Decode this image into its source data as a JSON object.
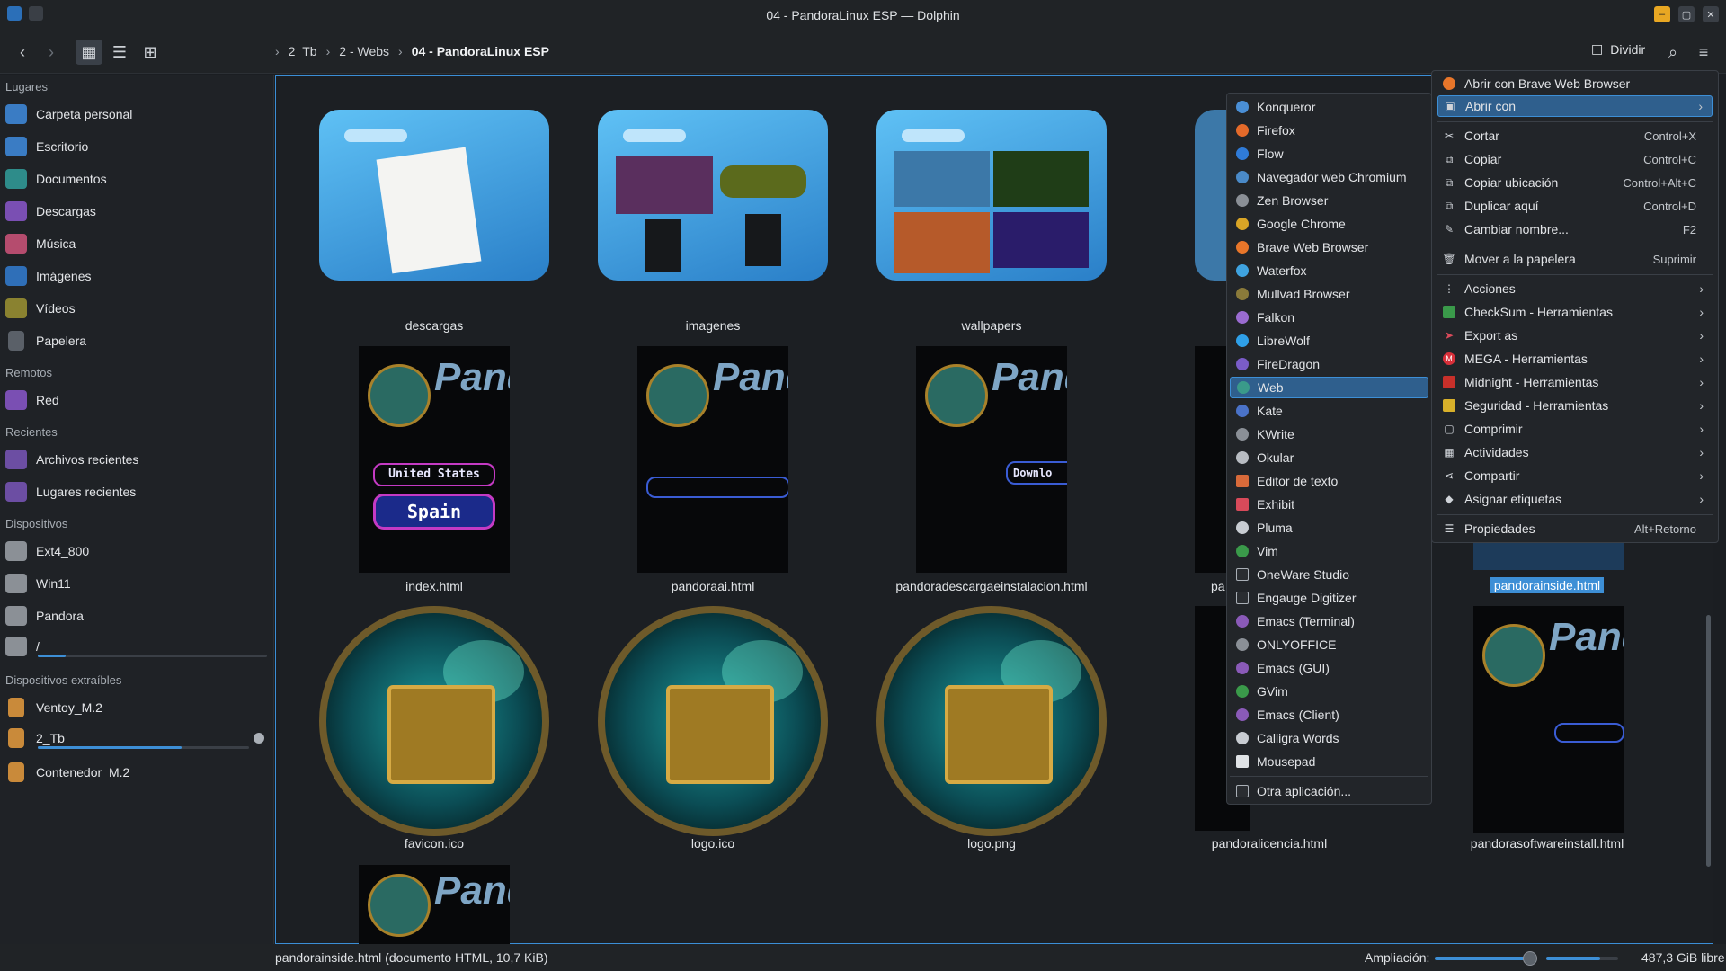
{
  "window": {
    "title": "04 - PandoraLinux ESP — Dolphin"
  },
  "toolbar": {
    "breadcrumbs": [
      "2_Tb",
      "2 - Webs",
      "04 - PandoraLinux ESP"
    ],
    "split_label": "Dividir"
  },
  "sidebar": {
    "sections": {
      "places": "Lugares",
      "remote": "Remotos",
      "recent": "Recientes",
      "devices": "Dispositivos",
      "removable": "Dispositivos extraíbles"
    },
    "places": [
      "Carpeta personal",
      "Escritorio",
      "Documentos",
      "Descargas",
      "Música",
      "Imágenes",
      "Vídeos",
      "Papelera"
    ],
    "remote": [
      "Red"
    ],
    "recent": [
      "Archivos recientes",
      "Lugares recientes"
    ],
    "devices": [
      "Ext4_800",
      "Win11",
      "Pandora",
      "/"
    ],
    "removable": [
      "Ventoy_M.2",
      "2_Tb",
      "Contenedor_M.2"
    ],
    "device_usage": {
      "root": 0.12,
      "2_Tb": 0.68
    }
  },
  "files": {
    "folders": [
      "descargas",
      "imagenes",
      "wallpapers"
    ],
    "html_files": [
      "index.html",
      "pandoraai.html",
      "pandoradescargaeinstalacion.html",
      "pa",
      "pandorainside.html"
    ],
    "images": [
      "favicon.ico",
      "logo.ico",
      "logo.png",
      "pandoralicencia.html",
      "pandorasoftwareinstall.html"
    ],
    "thumb_texts": {
      "pand": "Pand",
      "united": "United States",
      "spain": "Spain",
      "download": "Downlo"
    }
  },
  "context_menu": {
    "items": [
      {
        "label": "Abrir con Brave Web Browser",
        "shortcut": "",
        "submenu": false
      },
      {
        "label": "Abrir con",
        "shortcut": "",
        "submenu": true
      },
      {
        "label": "Cortar",
        "shortcut": "Control+X",
        "submenu": false
      },
      {
        "label": "Copiar",
        "shortcut": "Control+C",
        "submenu": false
      },
      {
        "label": "Copiar ubicación",
        "shortcut": "Control+Alt+C",
        "submenu": false
      },
      {
        "label": "Duplicar aquí",
        "shortcut": "Control+D",
        "submenu": false
      },
      {
        "label": "Cambiar nombre...",
        "shortcut": "F2",
        "submenu": false
      },
      {
        "label": "Mover a la papelera",
        "shortcut": "Suprimir",
        "submenu": false
      },
      {
        "label": "Acciones",
        "shortcut": "",
        "submenu": true
      },
      {
        "label": "CheckSum - Herramientas",
        "shortcut": "",
        "submenu": true
      },
      {
        "label": "Export as",
        "shortcut": "",
        "submenu": true
      },
      {
        "label": "MEGA - Herramientas",
        "shortcut": "",
        "submenu": true
      },
      {
        "label": "Midnight - Herramientas",
        "shortcut": "",
        "submenu": true
      },
      {
        "label": "Seguridad - Herramientas",
        "shortcut": "",
        "submenu": true
      },
      {
        "label": "Comprimir",
        "shortcut": "",
        "submenu": true
      },
      {
        "label": "Actividades",
        "shortcut": "",
        "submenu": true
      },
      {
        "label": "Compartir",
        "shortcut": "",
        "submenu": true
      },
      {
        "label": "Asignar etiquetas",
        "shortcut": "",
        "submenu": true
      },
      {
        "label": "Propiedades",
        "shortcut": "Alt+Retorno",
        "submenu": false
      }
    ]
  },
  "open_with_submenu": {
    "items": [
      "Konqueror",
      "Firefox",
      "Flow",
      "Navegador web Chromium",
      "Zen Browser",
      "Google Chrome",
      "Brave Web Browser",
      "Waterfox",
      "Mullvad Browser",
      "Falkon",
      "LibreWolf",
      "FireDragon",
      "Web",
      "Kate",
      "KWrite",
      "Okular",
      "Editor de texto",
      "Exhibit",
      "Pluma",
      "Vim",
      "OneWare Studio",
      "Engauge Digitizer",
      "Emacs (Terminal)",
      "ONLYOFFICE",
      "Emacs (GUI)",
      "GVim",
      "Emacs (Client)",
      "Calligra Words",
      "Mousepad"
    ],
    "other": "Otra aplicación...",
    "highlighted": "Web"
  },
  "statusbar": {
    "file_info": "pandorainside.html (documento HTML, 10,7 KiB)",
    "zoom_label": "Ampliación:",
    "free_space": "487,3 GiB libre"
  },
  "colors": {
    "accent": "#3d8fd6",
    "highlight": "#2f5f8d",
    "background": "#1c1f23"
  }
}
